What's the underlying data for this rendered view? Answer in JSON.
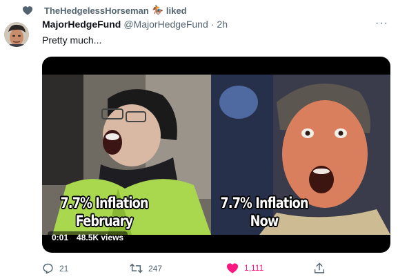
{
  "social_context": {
    "liker_name": "TheHedgelessHorseman",
    "liker_emoji": "🏇",
    "action": "liked"
  },
  "tweet": {
    "display_name": "MajorHedgeFund",
    "handle": "@MajorHedgeFund",
    "separator": "·",
    "timestamp": "2h",
    "text": "Pretty much...",
    "more_glyph": "···"
  },
  "media": {
    "caption_left_line1": "7.7% Inflation",
    "caption_left_line2": "February",
    "caption_right_line1": "7.7% Inflation",
    "caption_right_line2": "Now",
    "video_time": "0:01",
    "views": "48.5K views"
  },
  "actions": {
    "replies": "21",
    "retweets": "247",
    "likes": "1,111"
  },
  "colors": {
    "like_pink": "#f91880",
    "secondary_text": "#536471",
    "primary_text": "#0f1419"
  },
  "icons": [
    "heart-icon",
    "horse-emoji-icon",
    "more-icon",
    "reply-icon",
    "retweet-icon",
    "like-icon",
    "share-icon"
  ]
}
